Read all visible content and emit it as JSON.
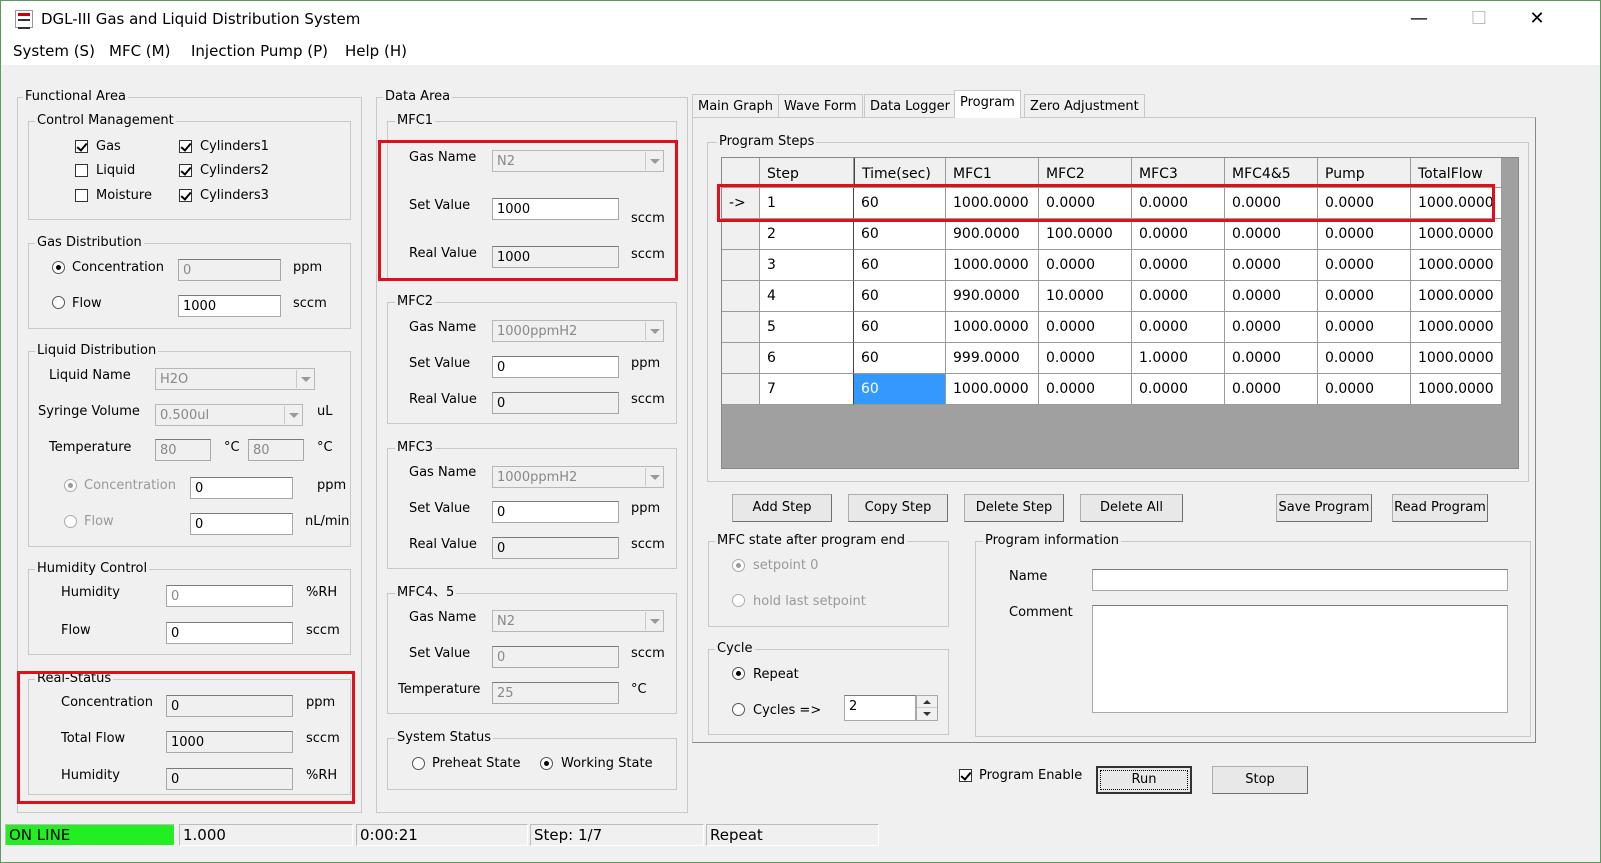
{
  "window": {
    "title": "DGL-III Gas and Liquid Distribution System",
    "minimize": "—",
    "maximize": "☐",
    "close": "✕"
  },
  "menu": [
    "System (S)",
    "MFC (M)",
    "Injection Pump (P)",
    "Help (H)"
  ],
  "functional": {
    "title": "Functional Area",
    "control": {
      "title": "Control Management",
      "gas": "Gas",
      "liquid": "Liquid",
      "moisture": "Moisture",
      "cyl1": "Cylinders1",
      "cyl2": "Cylinders2",
      "cyl3": "Cylinders3"
    },
    "gasdist": {
      "title": "Gas Distribution",
      "concentration": "Concentration",
      "conc_value": "0",
      "conc_unit": "ppm",
      "flow": "Flow",
      "flow_value": "1000",
      "flow_unit": "sccm"
    },
    "liquid": {
      "title": "Liquid Distribution",
      "name_label": "Liquid Name",
      "name_value": "H2O",
      "syringe_label": "Syringe Volume",
      "syringe_value": "0.500ul",
      "syringe_unit": "uL",
      "temp_label": "Temperature",
      "temp1": "80",
      "temp_unit1": "°C",
      "temp2": "80",
      "temp_unit2": "°C",
      "conc_label": "Concentration",
      "conc_value": "0",
      "conc_unit": "ppm",
      "flow_label": "Flow",
      "flow_value": "0",
      "flow_unit": "nL/min"
    },
    "humidity": {
      "title": "Humidity Control",
      "hum_label": "Humidity",
      "hum_value": "0",
      "hum_unit": "%RH",
      "flow_label": "Flow",
      "flow_value": "0",
      "flow_unit": "sccm"
    },
    "real": {
      "title": "Real-Status",
      "conc_label": "Concentration",
      "conc_value": "0",
      "conc_unit": "ppm",
      "total_label": "Total Flow",
      "total_value": "1000",
      "total_unit": "sccm",
      "hum_label": "Humidity",
      "hum_value": "0",
      "hum_unit": "%RH"
    }
  },
  "dataarea": {
    "title": "Data Area",
    "mfc1": {
      "title": "MFC1",
      "gas_label": "Gas Name",
      "gas_value": "N2",
      "set_label": "Set Value",
      "set_value": "1000",
      "set_unit": "sccm",
      "real_label": "Real Value",
      "real_value": "1000",
      "real_unit": "sccm"
    },
    "mfc2": {
      "title": "MFC2",
      "gas_label": "Gas Name",
      "gas_value": "1000ppmH2",
      "set_label": "Set Value",
      "set_value": "0",
      "set_unit": "ppm",
      "real_label": "Real Value",
      "real_value": "0",
      "real_unit": "sccm"
    },
    "mfc3": {
      "title": "MFC3",
      "gas_label": "Gas Name",
      "gas_value": "1000ppmH2",
      "set_label": "Set Value",
      "set_value": "0",
      "set_unit": "ppm",
      "real_label": "Real Value",
      "real_value": "0",
      "real_unit": "sccm"
    },
    "mfc45": {
      "title": "MFC4、5",
      "gas_label": "Gas Name",
      "gas_value": "N2",
      "set_label": "Set Value",
      "set_value": "0",
      "set_unit": "sccm",
      "temp_label": "Temperature",
      "temp_value": "25",
      "temp_unit": "°C"
    },
    "system": {
      "title": "System Status",
      "preheat": "Preheat State",
      "working": "Working State"
    }
  },
  "tabs": [
    "Main Graph",
    "Wave Form",
    "Data Logger",
    "Program",
    "Zero Adjustment"
  ],
  "program": {
    "steps_title": "Program Steps",
    "columns": [
      "",
      "Step",
      "Time(sec)",
      "MFC1",
      "MFC2",
      "MFC3",
      "MFC4&5",
      "Pump",
      "TotalFlow"
    ],
    "rows": [
      [
        "->",
        "1",
        "60",
        "1000.0000",
        "0.0000",
        "0.0000",
        "0.0000",
        "0.0000",
        "1000.0000"
      ],
      [
        "",
        "2",
        "60",
        "900.0000",
        "100.0000",
        "0.0000",
        "0.0000",
        "0.0000",
        "1000.0000"
      ],
      [
        "",
        "3",
        "60",
        "1000.0000",
        "0.0000",
        "0.0000",
        "0.0000",
        "0.0000",
        "1000.0000"
      ],
      [
        "",
        "4",
        "60",
        "990.0000",
        "10.0000",
        "0.0000",
        "0.0000",
        "0.0000",
        "1000.0000"
      ],
      [
        "",
        "5",
        "60",
        "1000.0000",
        "0.0000",
        "0.0000",
        "0.0000",
        "0.0000",
        "1000.0000"
      ],
      [
        "",
        "6",
        "60",
        "999.0000",
        "0.0000",
        "1.0000",
        "0.0000",
        "0.0000",
        "1000.0000"
      ],
      [
        "",
        "7",
        "60",
        "1000.0000",
        "0.0000",
        "0.0000",
        "0.0000",
        "0.0000",
        "1000.0000"
      ]
    ],
    "buttons": {
      "add": "Add Step",
      "copy": "Copy Step",
      "delete": "Delete Step",
      "delete_all": "Delete All",
      "save": "Save Program",
      "read": "Read Program"
    },
    "mfcstate": {
      "title": "MFC state after program end",
      "setpoint0": "setpoint 0",
      "hold": "hold last setpoint"
    },
    "info": {
      "title": "Program information",
      "name_label": "Name",
      "name_value": "",
      "comment_label": "Comment",
      "comment_value": ""
    },
    "cycle": {
      "title": "Cycle",
      "repeat": "Repeat",
      "cycles": "Cycles =>",
      "cycles_value": "2"
    },
    "enable": "Program Enable",
    "run": "Run",
    "stop": "Stop"
  },
  "statusbar": {
    "online": "ON LINE",
    "value": "1.000",
    "time": "0:00:21",
    "step": "Step: 1/7",
    "mode": "Repeat"
  },
  "colors": {
    "online": "#22ee22",
    "highlight": "#e0101a",
    "selection": "#3399ff"
  }
}
